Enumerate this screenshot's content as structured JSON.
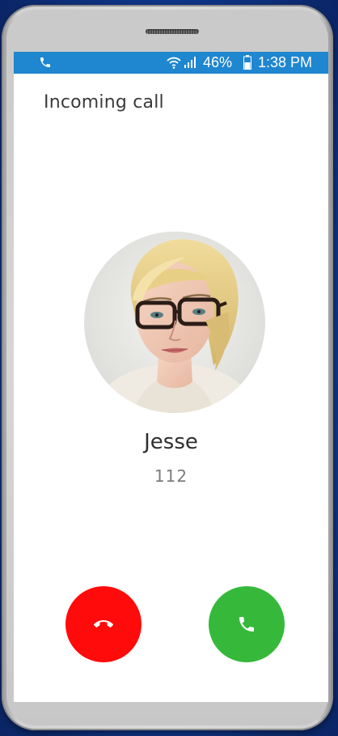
{
  "status_bar": {
    "battery_percent": "46%",
    "time": "1:38 PM",
    "left_icon": "phone-icon",
    "wifi_icon": "wifi-icon",
    "signal_icon": "signal-icon",
    "battery_icon": "battery-icon"
  },
  "call": {
    "title": "Incoming call",
    "caller_name": "Jesse",
    "caller_number": "112"
  },
  "actions": {
    "decline_icon": "phone-hangup-icon",
    "accept_icon": "phone-answer-icon"
  },
  "colors": {
    "status_bar": "#1f86d0",
    "decline": "#ff0b0b",
    "accept": "#36b93a",
    "background": "#123e9b"
  }
}
